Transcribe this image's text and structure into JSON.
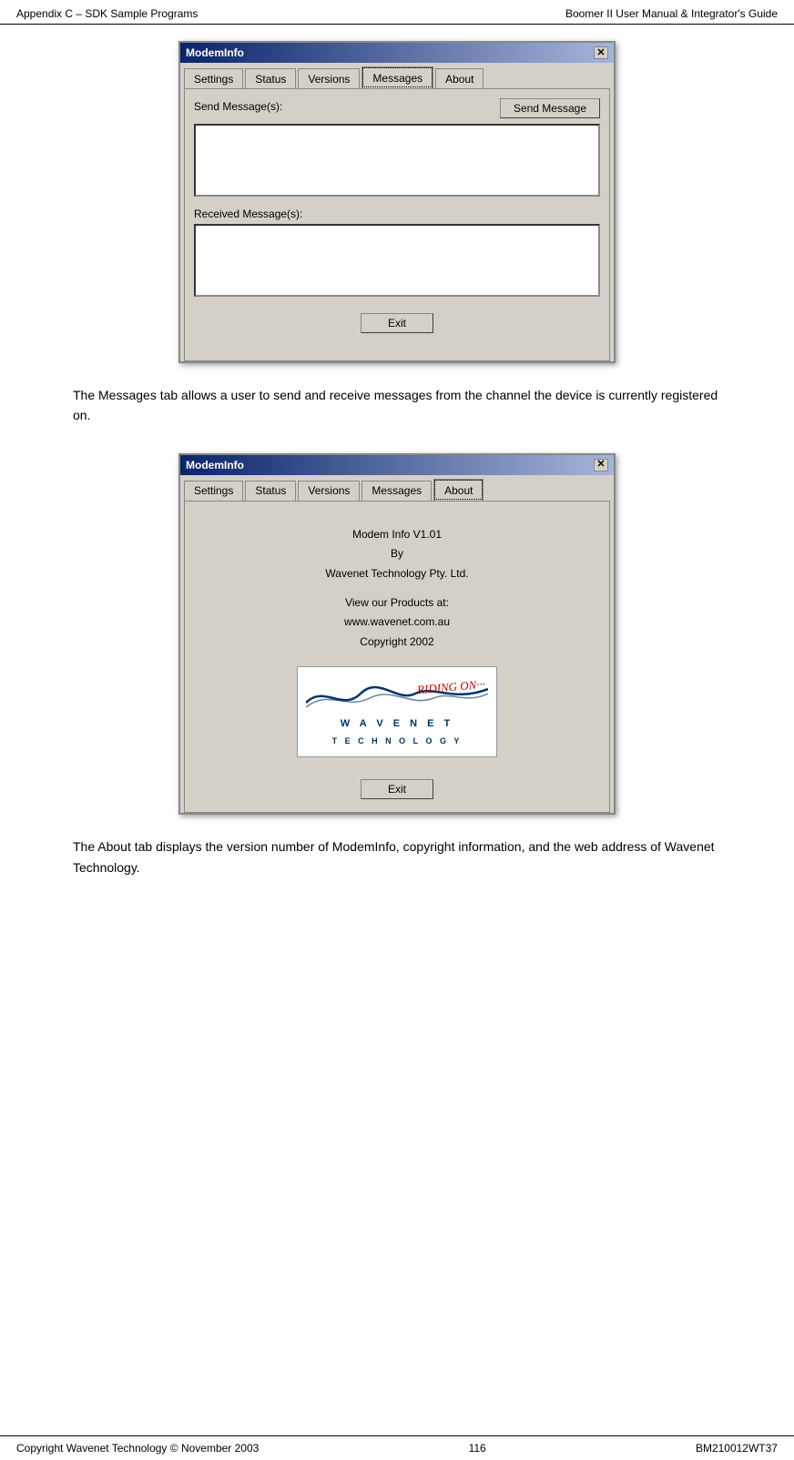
{
  "header": {
    "left": "Appendix C – SDK Sample Programs",
    "right": "Boomer II User Manual & Integrator's Guide"
  },
  "footer": {
    "left": "Copyright Wavenet Technology © November 2003",
    "center": "116",
    "right": "BM210012WT37"
  },
  "dialog_messages": {
    "title": "ModemInfo",
    "close_btn": "✕",
    "tabs": [
      {
        "label": "Settings"
      },
      {
        "label": "Status"
      },
      {
        "label": "Versions"
      },
      {
        "label": "Messages",
        "active": true
      },
      {
        "label": "About"
      }
    ],
    "send_label": "Send Message(s):",
    "send_button": "Send Message",
    "received_label": "Received Message(s):",
    "exit_button": "Exit"
  },
  "description_messages": "The Messages tab allows a user to send and receive messages from the channel the device is currently registered on.",
  "dialog_about": {
    "title": "ModemInfo",
    "close_btn": "✕",
    "tabs": [
      {
        "label": "Settings"
      },
      {
        "label": "Status"
      },
      {
        "label": "Versions"
      },
      {
        "label": "Messages"
      },
      {
        "label": "About",
        "active": true
      }
    ],
    "about_lines": [
      "Modem Info V1.01",
      "By",
      "Wavenet Technology Pty. Ltd.",
      "",
      "View our Products at:",
      "www.wavenet.com.au",
      "Copyright 2002"
    ],
    "logo": {
      "riding_on": "RIDING ON···",
      "wavenet": "W A V E N E T",
      "technology": "T E C H N O L O G Y"
    },
    "exit_button": "Exit"
  },
  "description_about": "The About tab displays the version number of ModemInfo, copyright information, and the web address of Wavenet Technology."
}
